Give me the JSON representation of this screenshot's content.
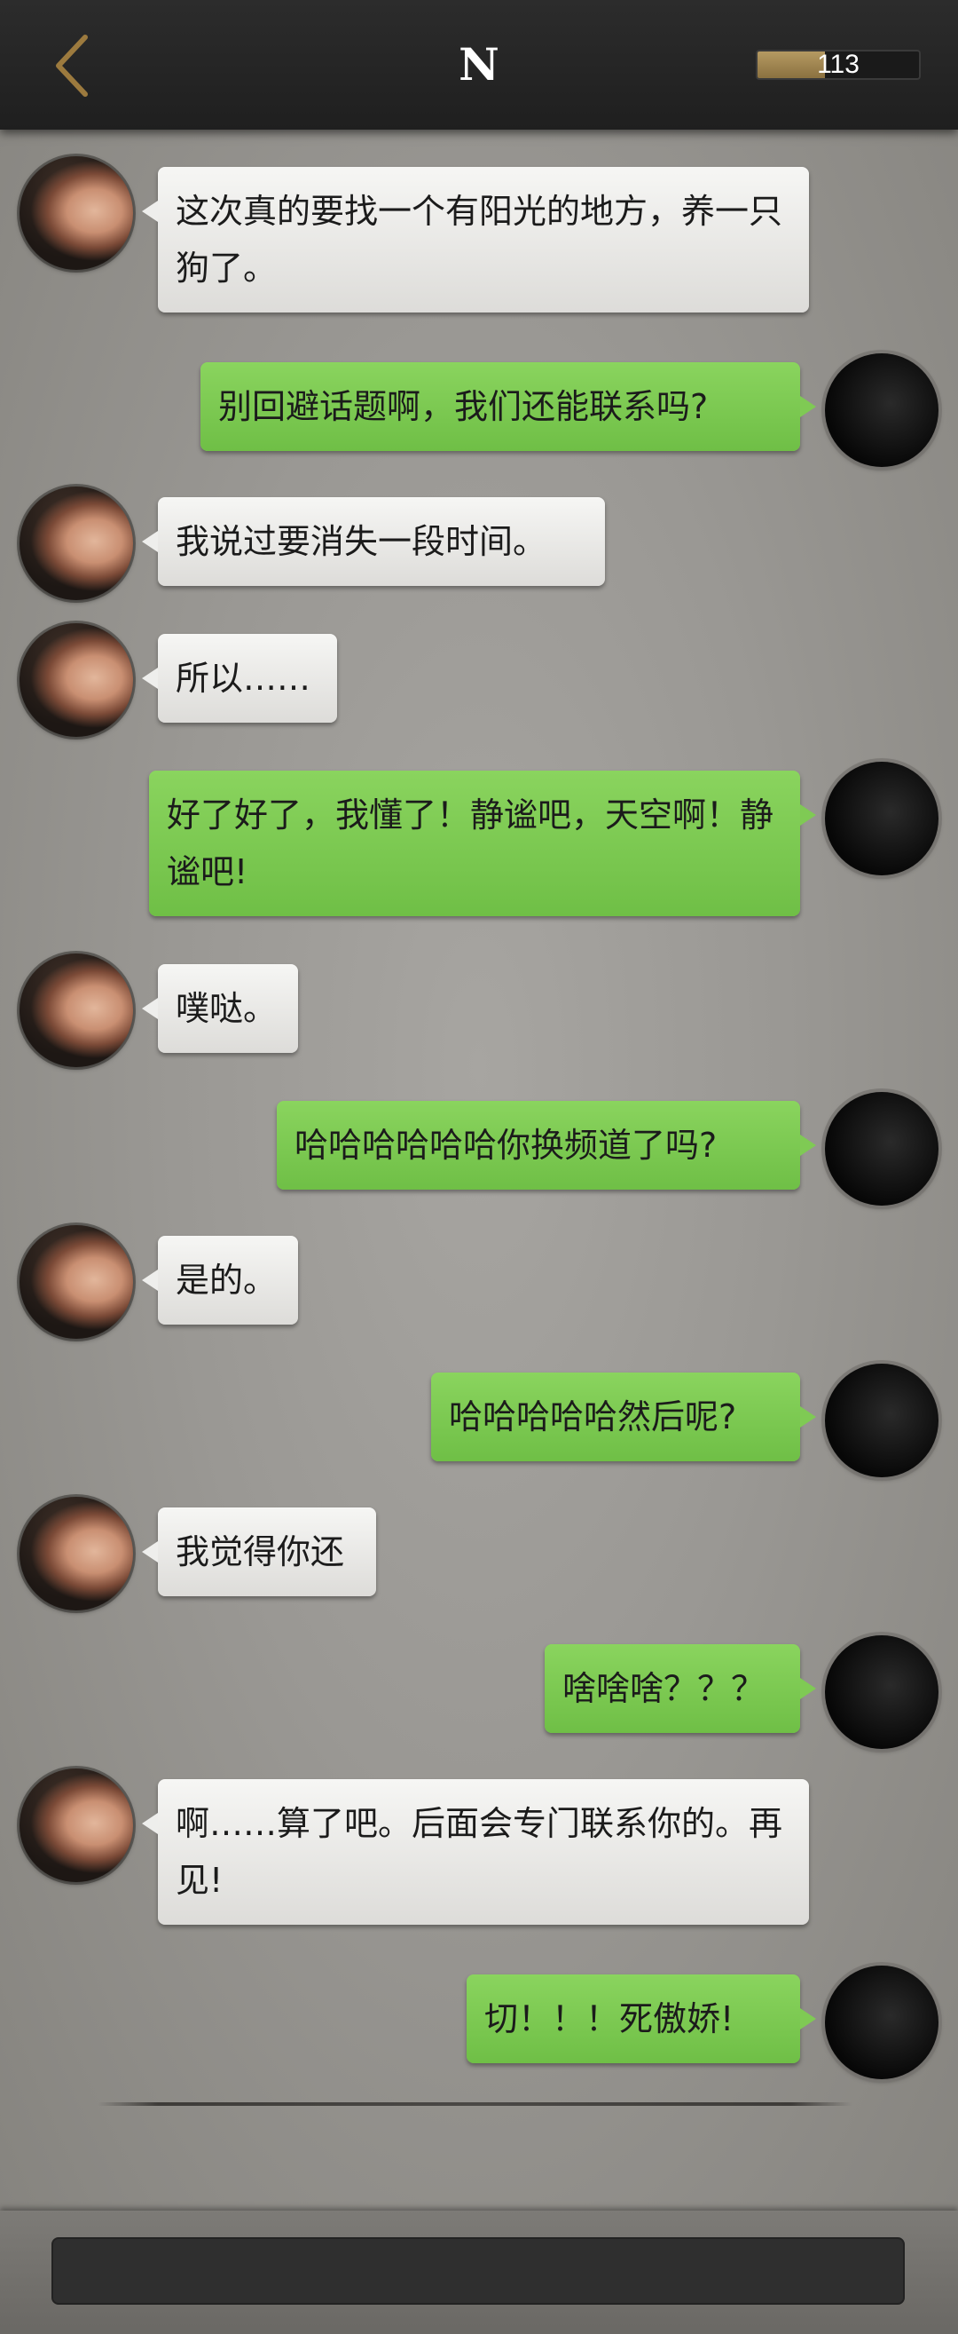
{
  "header": {
    "back_label": "返回",
    "title": "N",
    "progress_value": "113",
    "progress_fraction": 0.42
  },
  "messages": [
    {
      "side": "left",
      "text": "这次真的要找一个有阳光的地方，养一只狗了。"
    },
    {
      "side": "right",
      "text": "别回避话题啊，我们还能联系吗?"
    },
    {
      "side": "left",
      "text": "我说过要消失一段时间。"
    },
    {
      "side": "left",
      "text": "所以……"
    },
    {
      "side": "right",
      "text": "好了好了，我懂了！静谧吧，天空啊！静谧吧!"
    },
    {
      "side": "left",
      "text": "噗哒。"
    },
    {
      "side": "right",
      "text": "哈哈哈哈哈哈你换频道了吗?"
    },
    {
      "side": "left",
      "text": "是的。"
    },
    {
      "side": "right",
      "text": "哈哈哈哈哈然后呢?"
    },
    {
      "side": "left",
      "text": "我觉得你还"
    },
    {
      "side": "right",
      "text": "啥啥啥？？？"
    },
    {
      "side": "left",
      "text": "啊……算了吧。后面会专门联系你的。再见!"
    },
    {
      "side": "right",
      "text": "切！！！死傲娇!"
    }
  ],
  "input": {
    "value": "",
    "placeholder": ""
  },
  "colors": {
    "header_bg": "#232323",
    "sent_bubble": "#7fca54",
    "received_bubble": "#efefed",
    "progress_fill": "#a88d57"
  }
}
